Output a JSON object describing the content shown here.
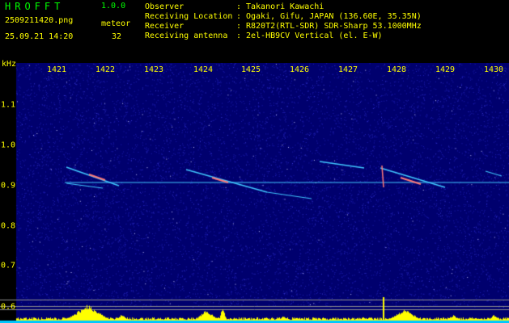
{
  "app": {
    "title": "HROFFT",
    "version": "1.0.0"
  },
  "capture": {
    "file": "2509211420.png",
    "datetime": "25.09.21 14:20",
    "meteor_label": "meteor",
    "meteor_count": "32"
  },
  "info": [
    {
      "key": "Observer",
      "value": "Takanori Kawachi"
    },
    {
      "key": "Receiving Location",
      "value": "Ogaki, Gifu, JAPAN (136.60E, 35.35N)"
    },
    {
      "key": "Receiver",
      "value": "R820T2(RTL-SDR) SDR-Sharp 53.1000MHz"
    },
    {
      "key": "Receiving antenna",
      "value": "2el-HB9CV Vertical (el. E-W)"
    }
  ],
  "axes": {
    "y_unit": "kHz",
    "x_ticks": [
      "1421",
      "1422",
      "1423",
      "1424",
      "1425",
      "1426",
      "1427",
      "1428",
      "1429",
      "1430"
    ],
    "y_ticks": [
      "1.1",
      "1.0",
      "0.9",
      "0.8",
      "0.7",
      "0.6"
    ]
  },
  "colors": {
    "background": "#000000",
    "text": "#ffff00",
    "title": "#00ff00",
    "noise": "#1414a0",
    "carrier": "#40c8ff",
    "meteor": "#ff7878",
    "level": "#ffff00",
    "baseline": "#00c8ff"
  }
}
